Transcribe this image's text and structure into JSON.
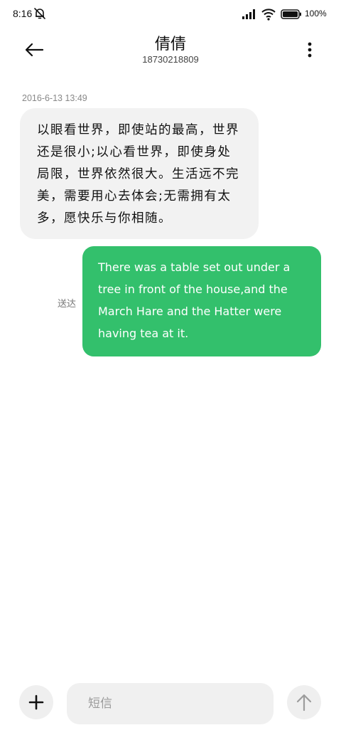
{
  "status_bar": {
    "time": "8:16",
    "battery": "100%",
    "icons": [
      "bell-off-icon",
      "signal-icon",
      "wifi-icon",
      "battery-icon"
    ]
  },
  "header": {
    "contact_name": "倩倩",
    "contact_number": "18730218809",
    "icons": [
      "back-arrow-icon",
      "more-vertical-icon"
    ]
  },
  "conversation": {
    "timestamp": "2016-6-13 13:49",
    "incoming_message": "以眼看世界，即使站的最高，世界还是很小;以心看世界，即使身处局限，世界依然很大。生活远不完美，需要用心去体会;无需拥有太多，愿快乐与你相随。",
    "outgoing_message": "There was a table set out under a tree in front of the house,and the March Hare and the Hatter were having tea at it.",
    "delivery_status": "送达"
  },
  "composer": {
    "placeholder": "短信",
    "icons": [
      "plus-icon",
      "send-arrow-icon"
    ]
  },
  "colors": {
    "outgoing_bubble": "#33c06c",
    "incoming_bubble": "#f2f2f2",
    "background": "#ffffff"
  }
}
